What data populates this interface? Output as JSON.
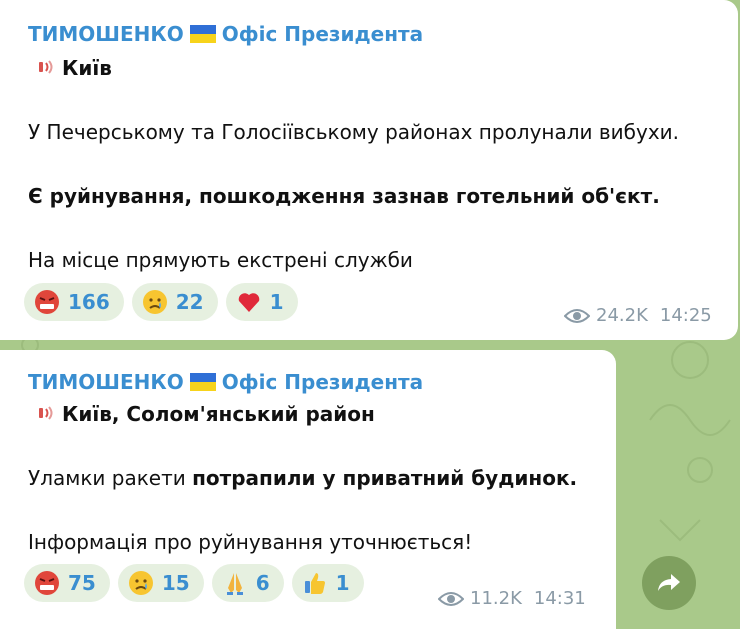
{
  "messages": [
    {
      "sender": {
        "name_left": "ТИМОШЕНКО",
        "name_right": "Офіс Президента"
      },
      "location": "Київ",
      "line1": "У Печерському та Голосіївському районах пролунали вибухи.",
      "line2_bold": "Є руйнування, пошкодження зазнав готельний об'єкт.",
      "line3": "На місце прямують екстрені служби",
      "reactions": [
        {
          "icon": "angry-face-icon",
          "count": "166"
        },
        {
          "icon": "crying-face-icon",
          "count": "22"
        },
        {
          "icon": "red-heart-icon",
          "count": "1"
        }
      ],
      "views": "24.2K",
      "time": "14:25"
    },
    {
      "sender": {
        "name_left": "ТИМОШЕНКО",
        "name_right": "Офіс Президента"
      },
      "location": "Київ, Солом'янський район",
      "line1_normal": "Уламки ракети ",
      "line1_bold": "потрапили у приватний будинок.",
      "line2": " Інформація про руйнування уточнюється!",
      "reactions": [
        {
          "icon": "angry-face-icon",
          "count": "75"
        },
        {
          "icon": "crying-face-icon",
          "count": "15"
        },
        {
          "icon": "folded-hands-icon",
          "count": "6"
        },
        {
          "icon": "thumbs-up-icon",
          "count": "1"
        }
      ],
      "views": "11.2K",
      "time": "14:31"
    }
  ],
  "colors": {
    "accent": "#3a8ed0",
    "background": "#a9c98a",
    "reaction_bg": "#e6f0e0",
    "meta": "#8a9aa6",
    "forward_button": "#7fa05f"
  }
}
